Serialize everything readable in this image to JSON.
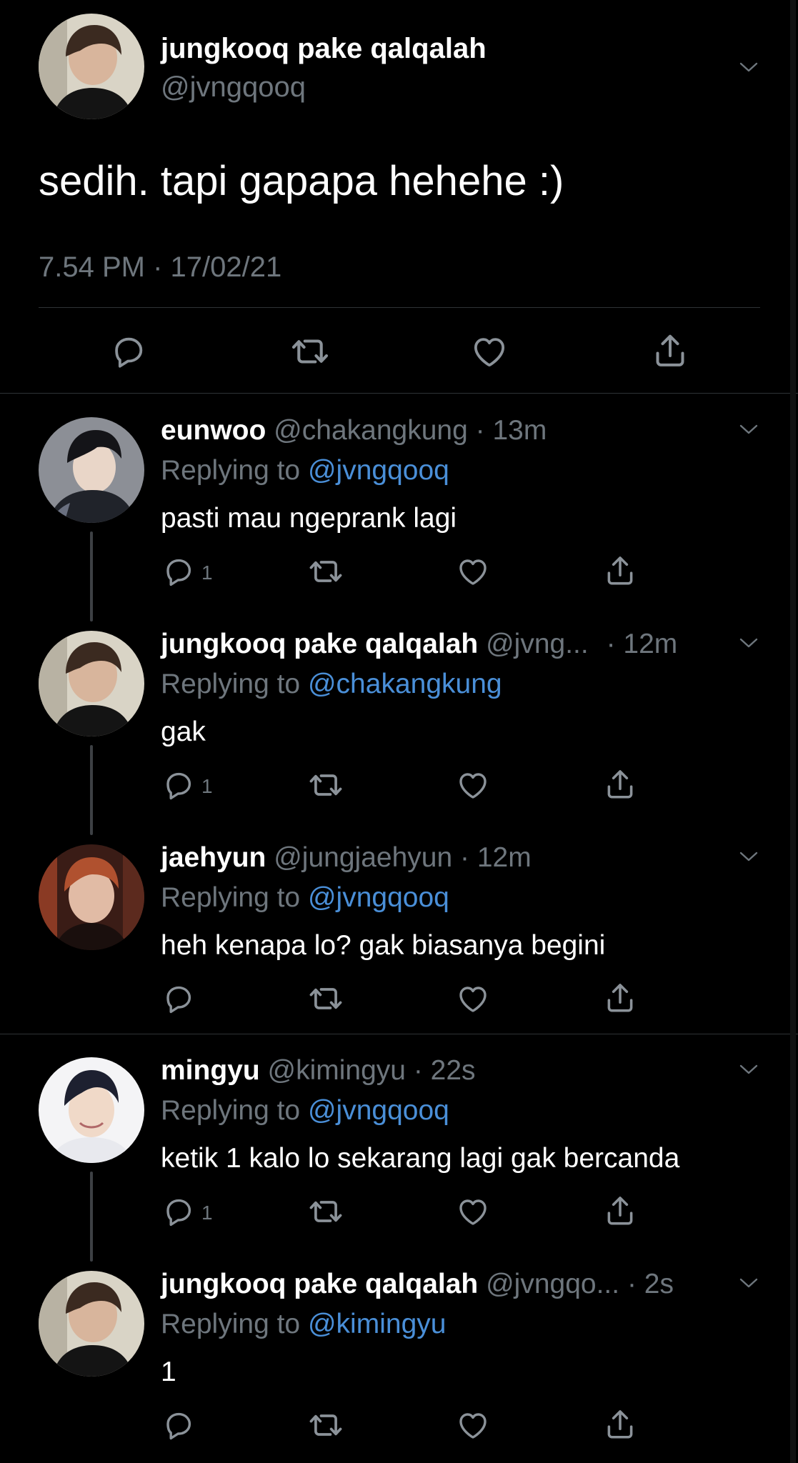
{
  "main_tweet": {
    "name": "jungkooq pake qalqalah",
    "handle": "@jvngqooq",
    "text": "sedih. tapi gapapa hehehe :)",
    "timestamp": "7.54 PM · 17/02/21"
  },
  "replies": [
    {
      "name": "eunwoo",
      "handle": "@chakangkung",
      "time": "· 13m",
      "replying_prefix": "Replying to",
      "replying_to": "@jvngqooq",
      "text": "pasti mau ngeprank lagi",
      "reply_count": "1"
    },
    {
      "name": "jungkooq pake qalqalah",
      "handle": "@jvng...",
      "time": "· 12m",
      "replying_prefix": "Replying to",
      "replying_to": "@chakangkung",
      "text": "gak",
      "reply_count": "1"
    },
    {
      "name": "jaehyun",
      "handle": "@jungjaehyun",
      "time": "· 12m",
      "replying_prefix": "Replying to",
      "replying_to": "@jvngqooq",
      "text": "heh kenapa lo? gak biasanya begini",
      "reply_count": ""
    },
    {
      "name": "mingyu",
      "handle": "@kimingyu",
      "time": "· 22s",
      "replying_prefix": "Replying to",
      "replying_to": "@jvngqooq",
      "text": "ketik 1 kalo lo sekarang lagi gak bercanda",
      "reply_count": "1"
    },
    {
      "name": "jungkooq pake qalqalah",
      "handle": "@jvngqo...",
      "time": "· 2s",
      "replying_prefix": "Replying to",
      "replying_to": "@kimingyu",
      "text": "1",
      "reply_count": ""
    }
  ],
  "icons": {
    "reply": "reply-icon",
    "retweet": "retweet-icon",
    "like": "like-icon",
    "share": "share-icon",
    "more": "chevron-down-icon"
  },
  "colors": {
    "background": "#000000",
    "link": "#4a8fd8",
    "muted": "#6e767d",
    "divider": "#2f3336"
  }
}
